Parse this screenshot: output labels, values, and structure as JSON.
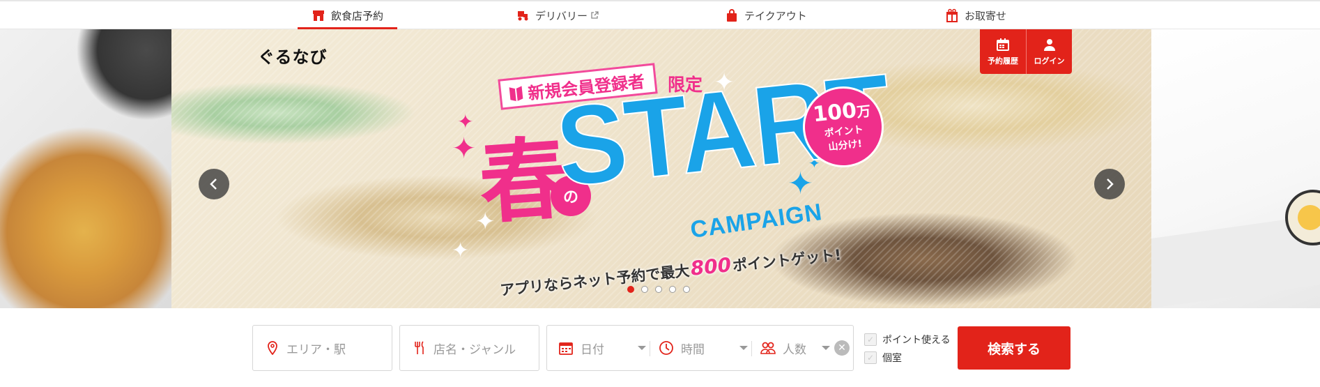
{
  "nav": {
    "tabs": [
      {
        "label": "飲食店予約",
        "icon": "shop-icon",
        "active": true
      },
      {
        "label": "デリバリー",
        "icon": "delivery-icon",
        "external": true
      },
      {
        "label": "テイクアウト",
        "icon": "bag-icon"
      },
      {
        "label": "お取寄せ",
        "icon": "gift-icon"
      }
    ],
    "accent_color": "#e2231a"
  },
  "header": {
    "logo_text": "ぐるなび",
    "actions": [
      {
        "label": "予約履歴",
        "icon": "calendar-icon"
      },
      {
        "label": "ログイン",
        "icon": "user-icon"
      }
    ]
  },
  "banner": {
    "member_badge": "新規会員登録者",
    "limited": "限定",
    "haru": "春",
    "no": "の",
    "start": "START",
    "campaign": "CAMPAIGN",
    "points_amount": "100",
    "points_unit": "万",
    "points_line2": "ポイント",
    "points_line3": "山分け!",
    "sub_prefix": "アプリならネット予約で最大",
    "sub_number": "800",
    "sub_suffix": "ポイントゲット!",
    "slide_count": 5,
    "active_slide": 1,
    "pink": "#f02f8b",
    "blue": "#1aa3e8"
  },
  "search": {
    "area_placeholder": "エリア・駅",
    "shop_placeholder": "店名・ジャンル",
    "date_placeholder": "日付",
    "time_placeholder": "時間",
    "people_placeholder": "人数",
    "options": [
      {
        "label": "ポイント使える",
        "checked": false
      },
      {
        "label": "個室",
        "checked": false
      }
    ],
    "button_label": "検索する"
  }
}
